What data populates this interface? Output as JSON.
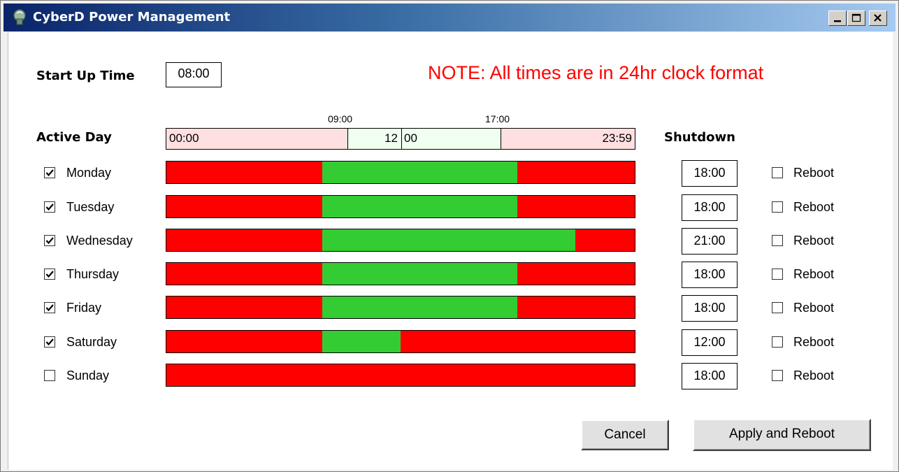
{
  "window": {
    "title": "CyberD Power Management",
    "titlebar_colors": {
      "start": "#0a246a",
      "end": "#a6caf0"
    }
  },
  "startup": {
    "label": "Start Up Time",
    "value": "08:00"
  },
  "note": "NOTE: All times are in 24hr clock format",
  "schedule": {
    "active_day_label": "Active Day",
    "shutdown_label": "Shutdown",
    "reboot_label": "Reboot",
    "timeline": {
      "start": "00:00",
      "noon_hour": "12",
      "noon_minutes": "00",
      "end": "23:59",
      "window_start": "09:00",
      "window_end": "17:00"
    },
    "days": [
      {
        "name": "Monday",
        "active": true,
        "on_start_hour": 8,
        "shutdown": "18:00",
        "reboot": false
      },
      {
        "name": "Tuesday",
        "active": true,
        "on_start_hour": 8,
        "shutdown": "18:00",
        "reboot": false
      },
      {
        "name": "Wednesday",
        "active": true,
        "on_start_hour": 8,
        "shutdown": "21:00",
        "reboot": false
      },
      {
        "name": "Thursday",
        "active": true,
        "on_start_hour": 8,
        "shutdown": "18:00",
        "reboot": false
      },
      {
        "name": "Friday",
        "active": true,
        "on_start_hour": 8,
        "shutdown": "18:00",
        "reboot": false
      },
      {
        "name": "Saturday",
        "active": true,
        "on_start_hour": 8,
        "shutdown": "12:00",
        "reboot": false
      },
      {
        "name": "Sunday",
        "active": false,
        "on_start_hour": 8,
        "shutdown": "18:00",
        "reboot": false
      }
    ]
  },
  "buttons": {
    "cancel": "Cancel",
    "apply": "Apply and Reboot"
  },
  "colors": {
    "off": "#ff0000",
    "on": "#33cc33",
    "note": "#ff0000",
    "timeline_off": "#ffe0e0",
    "timeline_on": "#f0fff0"
  }
}
